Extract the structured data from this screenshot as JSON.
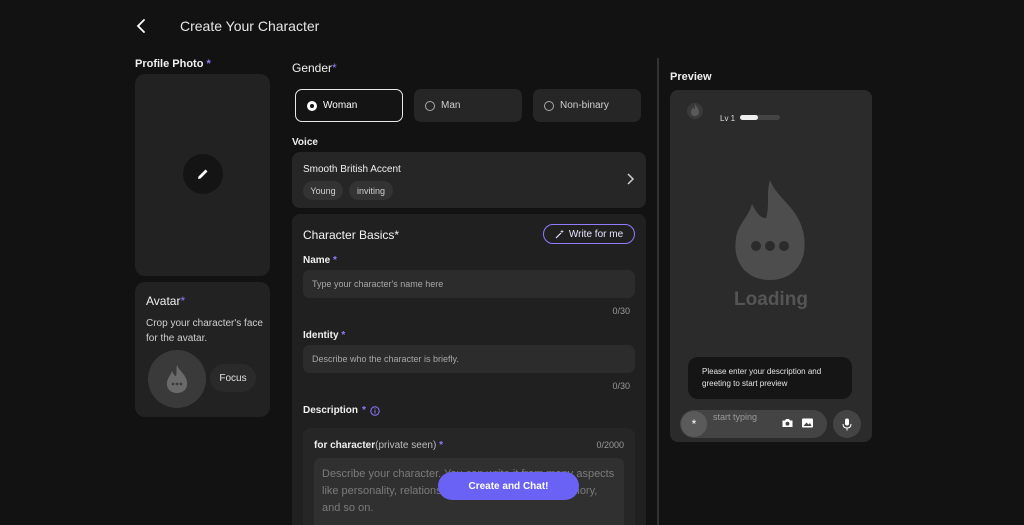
{
  "header": {
    "title": "Create Your Character",
    "back_icon": "chevron-left-icon"
  },
  "left": {
    "profile_photo_label": "Profile Photo",
    "required_mark": "*",
    "edit_icon": "pencil-icon",
    "avatar": {
      "title": "Avatar",
      "description": "Crop your character's face for the avatar.",
      "focus_label": "Focus"
    }
  },
  "gender": {
    "label": "Gender",
    "options": [
      "Woman",
      "Man",
      "Non-binary"
    ],
    "selected": "Woman"
  },
  "voice": {
    "label": "Voice",
    "name": "Smooth British Accent",
    "tags": [
      "Young",
      "inviting"
    ]
  },
  "basics": {
    "title": "Character Basics",
    "write_for_me": "Write for me",
    "name": {
      "label": "Name",
      "placeholder": "Type your character's name here",
      "counter": "0/30"
    },
    "identity": {
      "label": "Identity",
      "placeholder": "Describe who the character is briefly.",
      "counter": "0/30"
    },
    "description": {
      "label": "Description",
      "sub_label": "for character",
      "sub_label_note": "(private seen)",
      "counter": "0/2000",
      "placeholder": "Describe your character. You can write it from many aspects like personality, relationships, internal thoughts, memory, and so on."
    }
  },
  "create_button": "Create and Chat!",
  "preview": {
    "label": "Preview",
    "level": "Lv 1",
    "level_progress": 0.45,
    "loading": "Loading",
    "hint": "Please enter your description and greeting to start preview",
    "star": "*",
    "input_placeholder": "start typing"
  },
  "colors": {
    "accent": "#6a62f5",
    "accent_outline": "#8f7cff",
    "background": "#121212",
    "card": "#262626"
  }
}
